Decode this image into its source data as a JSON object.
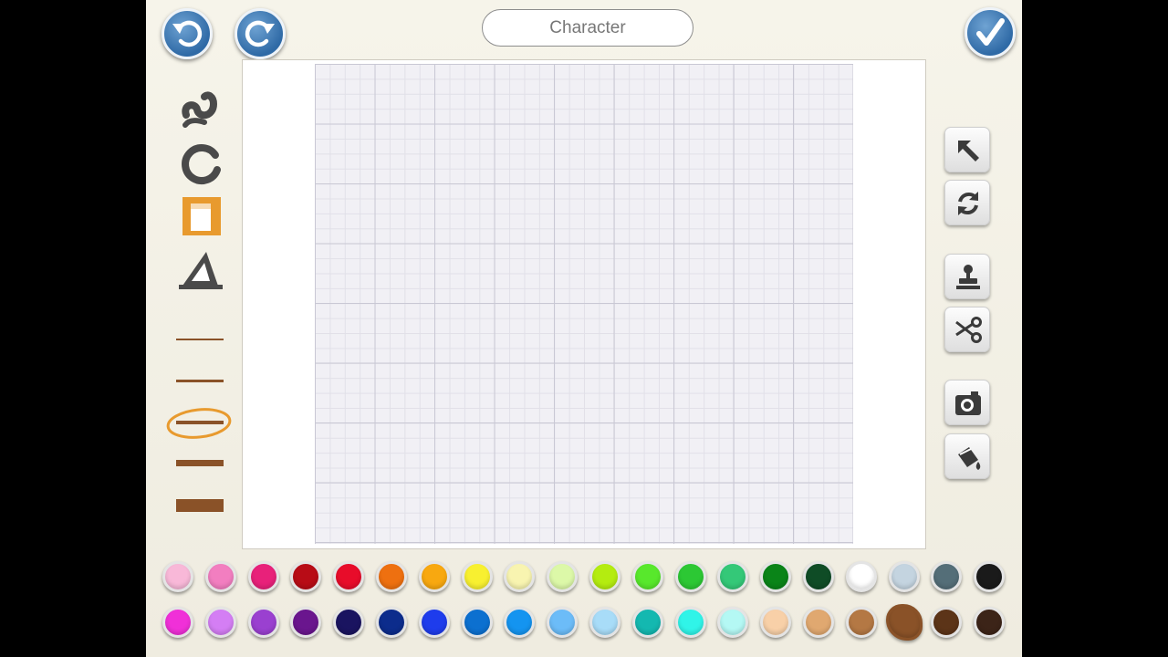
{
  "header": {
    "title": "Character"
  },
  "colors": {
    "accent": "#e89a2e",
    "button_blue": "#3a76b3",
    "brush": "#8a5228"
  },
  "shape_tools": [
    {
      "icon": "squiggle-icon",
      "selected": false
    },
    {
      "icon": "circle-icon",
      "selected": false
    },
    {
      "icon": "square-icon",
      "selected": true
    },
    {
      "icon": "triangle-icon",
      "selected": false
    }
  ],
  "brush_sizes": [
    {
      "size": 1,
      "selected": false
    },
    {
      "size": 2,
      "selected": false
    },
    {
      "size": 3,
      "selected": true
    },
    {
      "size": 4,
      "selected": false
    },
    {
      "size": 5,
      "selected": false
    }
  ],
  "side_tools": [
    "select-arrow-icon",
    "rotate-icon",
    "stamp-icon",
    "scissors-icon",
    "camera-icon",
    "paint-bucket-icon"
  ],
  "palette": {
    "row1": [
      "#f8b8d8",
      "#f27ec0",
      "#e8217a",
      "#b80c16",
      "#e80c2a",
      "#ee7010",
      "#f8a810",
      "#f8f030",
      "#f8f4b0",
      "#dcf8a8",
      "#b4ec10",
      "#58e82c",
      "#2cc834",
      "#34c878",
      "#0a8418",
      "#0f4c26",
      "#ffffff",
      "#c4d4e0",
      "#546e78",
      "#1a1a1a"
    ],
    "row2": [
      "#f030d8",
      "#d47ef4",
      "#9a40d0",
      "#6a168e",
      "#1a1460",
      "#0c2c8c",
      "#1e3cec",
      "#0c70d0",
      "#1494f0",
      "#6cbcf8",
      "#a8dcf8",
      "#14b8b0",
      "#30f4e8",
      "#b4f8f4",
      "#f8d0a8",
      "#e0a870",
      "#b47844",
      "#8a5228",
      "#5c3418",
      "#3c2418"
    ],
    "selected": "#8a5228"
  }
}
